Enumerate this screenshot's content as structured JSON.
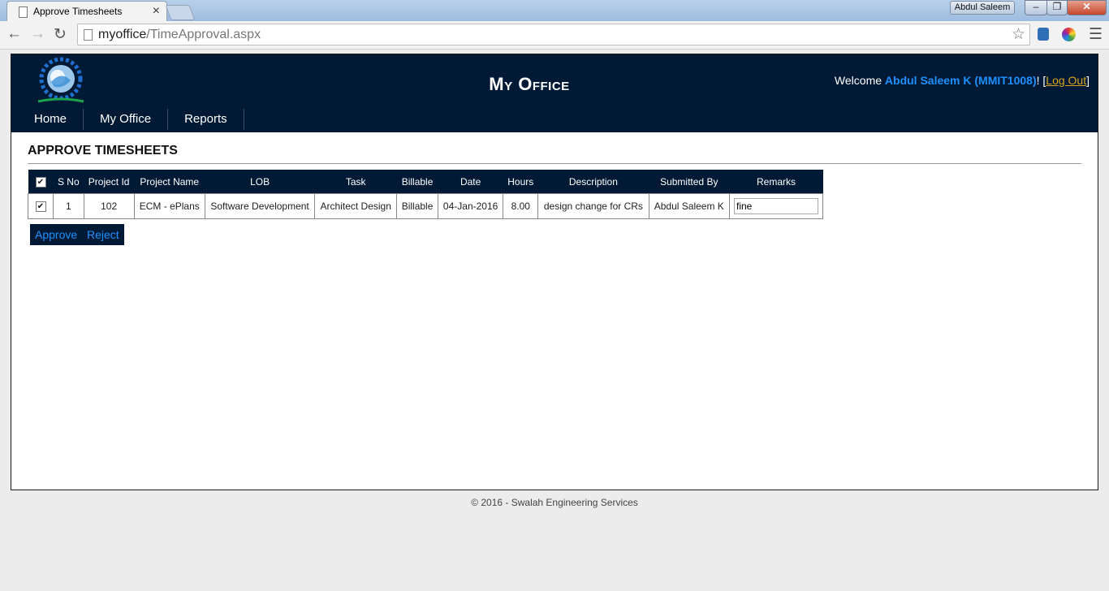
{
  "browser": {
    "tab_title": "Approve Timesheets",
    "tab_close": "×",
    "user_badge": "Abdul Saleem",
    "url_host": "myoffice",
    "url_path": "/TimeApproval.aspx",
    "window_buttons": [
      "–",
      "❐",
      "✕"
    ]
  },
  "header": {
    "site_title": "My Office",
    "welcome_prefix": "Welcome ",
    "user_display": "Abdul Saleem K (MMIT1008)",
    "welcome_suffix": "! [",
    "logout_label": "Log Out",
    "close_bracket": "]"
  },
  "nav": {
    "items": [
      {
        "label": "Home"
      },
      {
        "label": "My Office"
      },
      {
        "label": "Reports"
      }
    ]
  },
  "main": {
    "heading": "APPROVE TIMESHEETS",
    "table": {
      "columns": [
        "S No",
        "Project Id",
        "Project Name",
        "LOB",
        "Task",
        "Billable",
        "Date",
        "Hours",
        "Description",
        "Submitted By",
        "Remarks"
      ],
      "header_checked": true,
      "rows": [
        {
          "checked": true,
          "sno": "1",
          "project_id": "102",
          "project_name": "ECM - ePlans",
          "lob": "Software Development",
          "task": "Architect Design",
          "billable": "Billable",
          "date": "04-Jan-2016",
          "hours": "8.00",
          "description": "design change for CRs",
          "submitted_by": "Abdul Saleem K",
          "remarks": "fine"
        }
      ]
    },
    "approve_label": "Approve",
    "reject_label": "Reject"
  },
  "footer": {
    "text": "© 2016 - Swalah Engineering Services"
  },
  "colors": {
    "header_bg": "#001a35",
    "accent": "#1e90ff",
    "logout": "#d8a521"
  },
  "icons": {
    "back": "back-arrow-icon",
    "forward": "forward-arrow-icon",
    "reload": "reload-icon",
    "star": "star-icon",
    "menu": "hamburger-menu-icon"
  }
}
